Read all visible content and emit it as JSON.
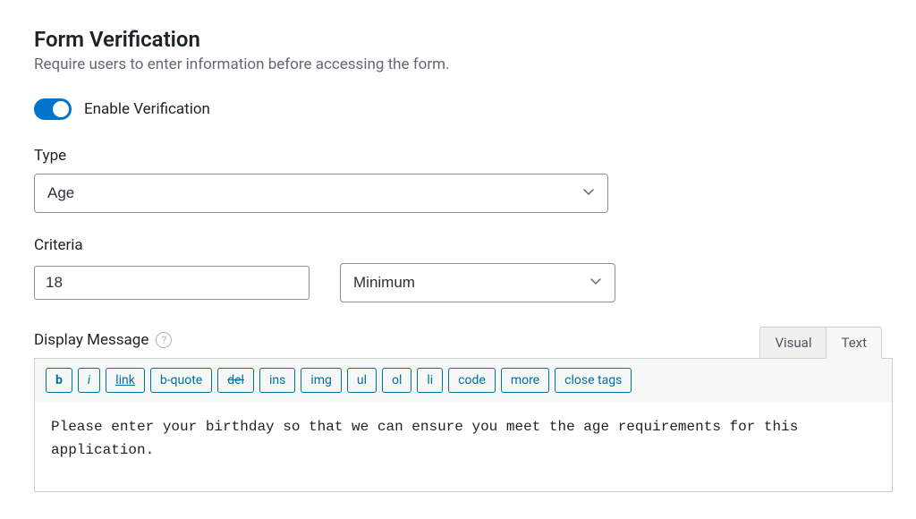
{
  "header": {
    "title": "Form Verification",
    "description": "Require users to enter information before accessing the form."
  },
  "toggle": {
    "label": "Enable Verification",
    "enabled": true
  },
  "type": {
    "label": "Type",
    "value": "Age"
  },
  "criteria": {
    "label": "Criteria",
    "value": "18",
    "select_value": "Minimum"
  },
  "display_message": {
    "label": "Display Message",
    "tabs": {
      "visual": "Visual",
      "text": "Text"
    },
    "quicktags": {
      "b": "b",
      "i": "i",
      "link": "link",
      "bquote": "b-quote",
      "del": "del",
      "ins": "ins",
      "img": "img",
      "ul": "ul",
      "ol": "ol",
      "li": "li",
      "code": "code",
      "more": "more",
      "close": "close tags"
    },
    "content": "Please enter your birthday so that we can ensure you meet the age requirements for this application."
  }
}
